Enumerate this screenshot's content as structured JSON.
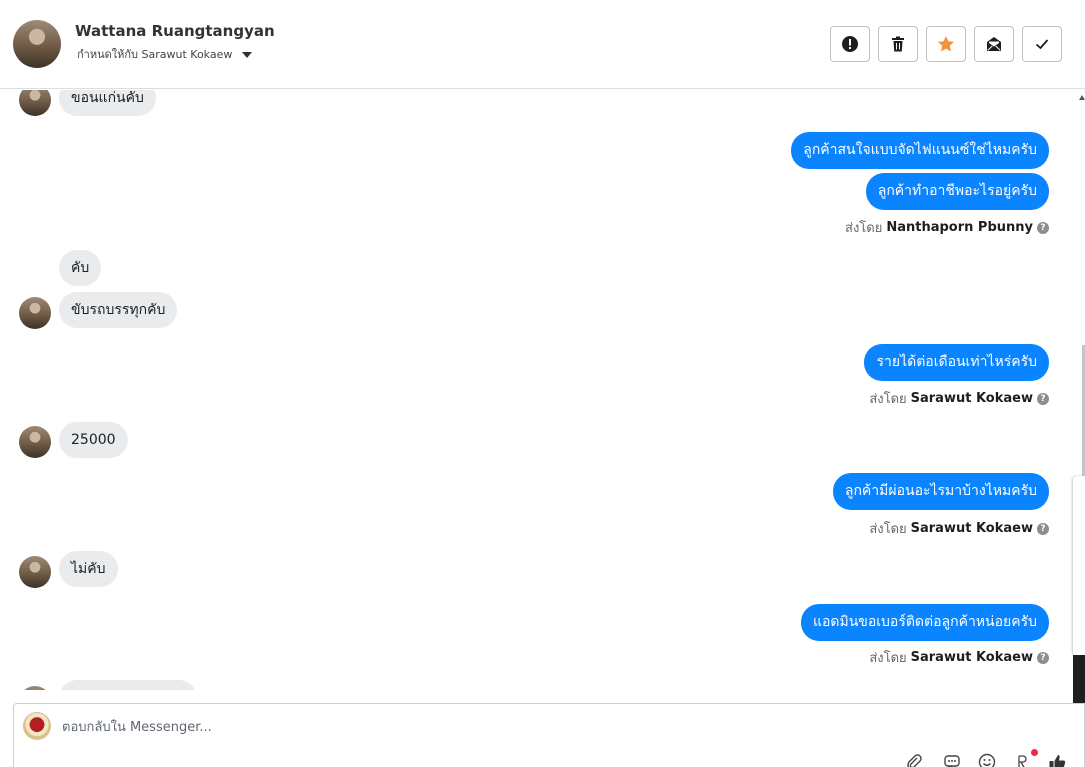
{
  "header": {
    "name": "Wattana Ruangtangyan",
    "assigned_label": "กำหนดให้กับ Sarawut Kokaew"
  },
  "toolbar": {
    "buttons": [
      {
        "name": "spam",
        "icon": "alert-circle-icon"
      },
      {
        "name": "delete",
        "icon": "trash-icon"
      },
      {
        "name": "star",
        "icon": "star-icon",
        "color": "#f5923e"
      },
      {
        "name": "mark-unread",
        "icon": "envelope-icon"
      },
      {
        "name": "done",
        "icon": "check-icon"
      }
    ]
  },
  "messages": [
    {
      "dir": "in",
      "text": "ขอนแก่นคับ"
    },
    {
      "dir": "out",
      "text": "ลูกค้าสนใจแบบจัดไฟแนนซ์ใช่ไหมครับ"
    },
    {
      "dir": "out",
      "text": "ลูกค้าทำอาชีพอะไรอยู่ครับ"
    },
    {
      "dir": "meta",
      "prefix": "ส่งโดย",
      "sender": "Nanthaporn Pbunny"
    },
    {
      "dir": "in",
      "text": "คับ"
    },
    {
      "dir": "in",
      "text": "ขับรถบรรทุกคับ"
    },
    {
      "dir": "out",
      "text": "รายได้ต่อเดือนเท่าไหร่ครับ"
    },
    {
      "dir": "meta",
      "prefix": "ส่งโดย",
      "sender": "Sarawut Kokaew"
    },
    {
      "dir": "in",
      "text": "25000"
    },
    {
      "dir": "out",
      "text": "ลูกค้ามีผ่อนอะไรมาบ้างไหมครับ"
    },
    {
      "dir": "meta",
      "prefix": "ส่งโดย",
      "sender": "Sarawut Kokaew"
    },
    {
      "dir": "in",
      "text": "ไม่คับ"
    },
    {
      "dir": "out",
      "text": "แอดมินขอเบอร์ติดต่อลูกค้าหน่อยครับ"
    },
    {
      "dir": "meta",
      "prefix": "ส่งโดย",
      "sender": "Sarawut Kokaew"
    }
  ],
  "composer": {
    "placeholder": "ตอบกลับใน Messenger...",
    "icons": [
      "paperclip-icon",
      "saved-reply-icon",
      "emoji-icon",
      "app-icon",
      "thumbs-up-icon"
    ]
  },
  "colors": {
    "outgoing_bubble": "#0b84ff",
    "incoming_bubble": "#e9ebed",
    "star": "#f5923e"
  }
}
